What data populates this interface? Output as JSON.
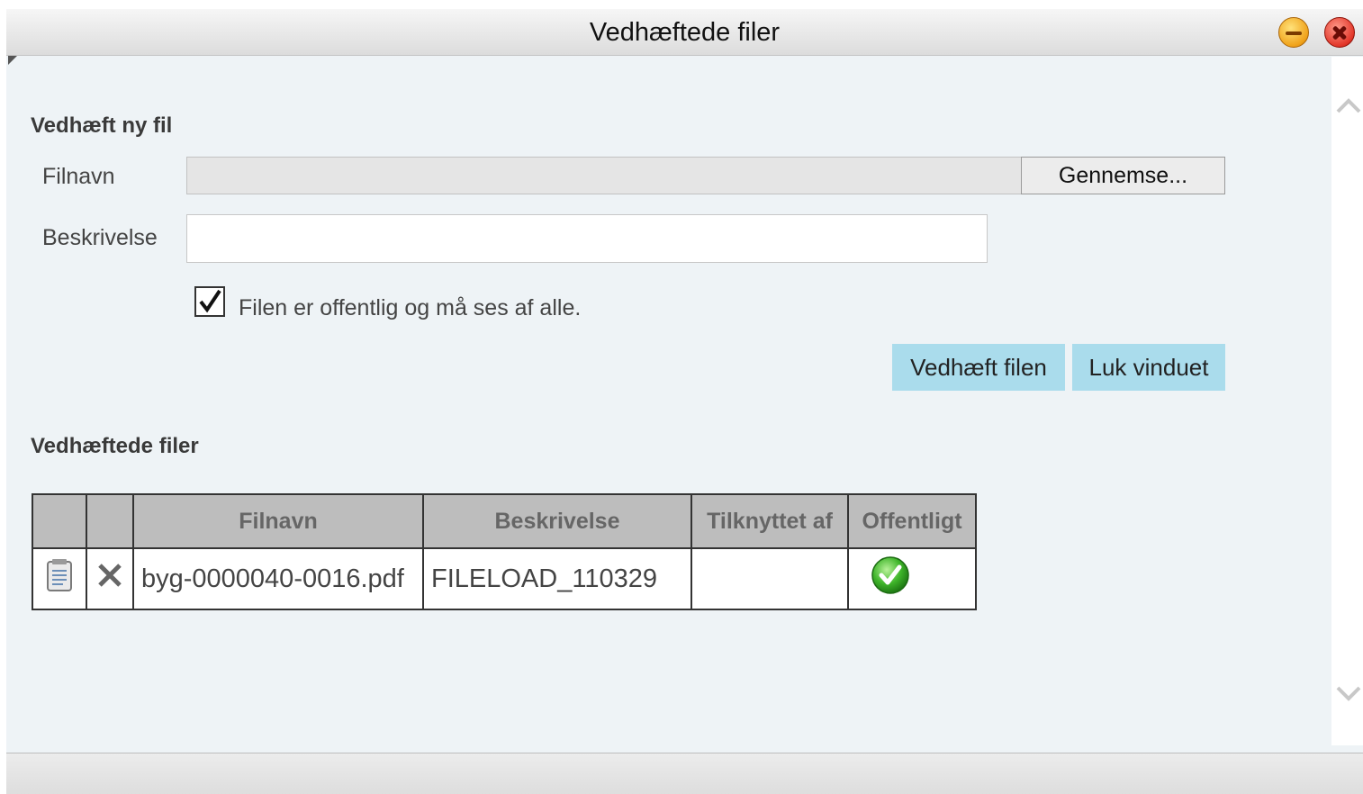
{
  "window": {
    "title": "Vedhæftede filer"
  },
  "attach_form": {
    "heading": "Vedhæft ny fil",
    "filename_label": "Filnavn",
    "filename_value": "",
    "browse_label": "Gennemse...",
    "description_label": "Beskrivelse",
    "description_value": "",
    "public_checked": true,
    "public_label": "Filen er offentlig og må ses af alle.",
    "attach_button": "Vedhæft filen",
    "close_button": "Luk vinduet"
  },
  "attached_files": {
    "heading": "Vedhæftede filer",
    "columns": [
      "",
      "",
      "Filnavn",
      "Beskrivelse",
      "Tilknyttet af",
      "Offentligt"
    ],
    "rows": [
      {
        "view_icon": "document-icon",
        "delete_icon": "delete-x-icon",
        "filename": "byg-0000040-0016.pdf",
        "description": "FILELOAD_110329",
        "attached_by": "",
        "public": true,
        "public_icon": "green-check-icon"
      }
    ]
  },
  "colors": {
    "button_bg": "#aadcec",
    "panel_bg": "#eef3f6",
    "header_cell_bg": "#bdbdbd"
  }
}
